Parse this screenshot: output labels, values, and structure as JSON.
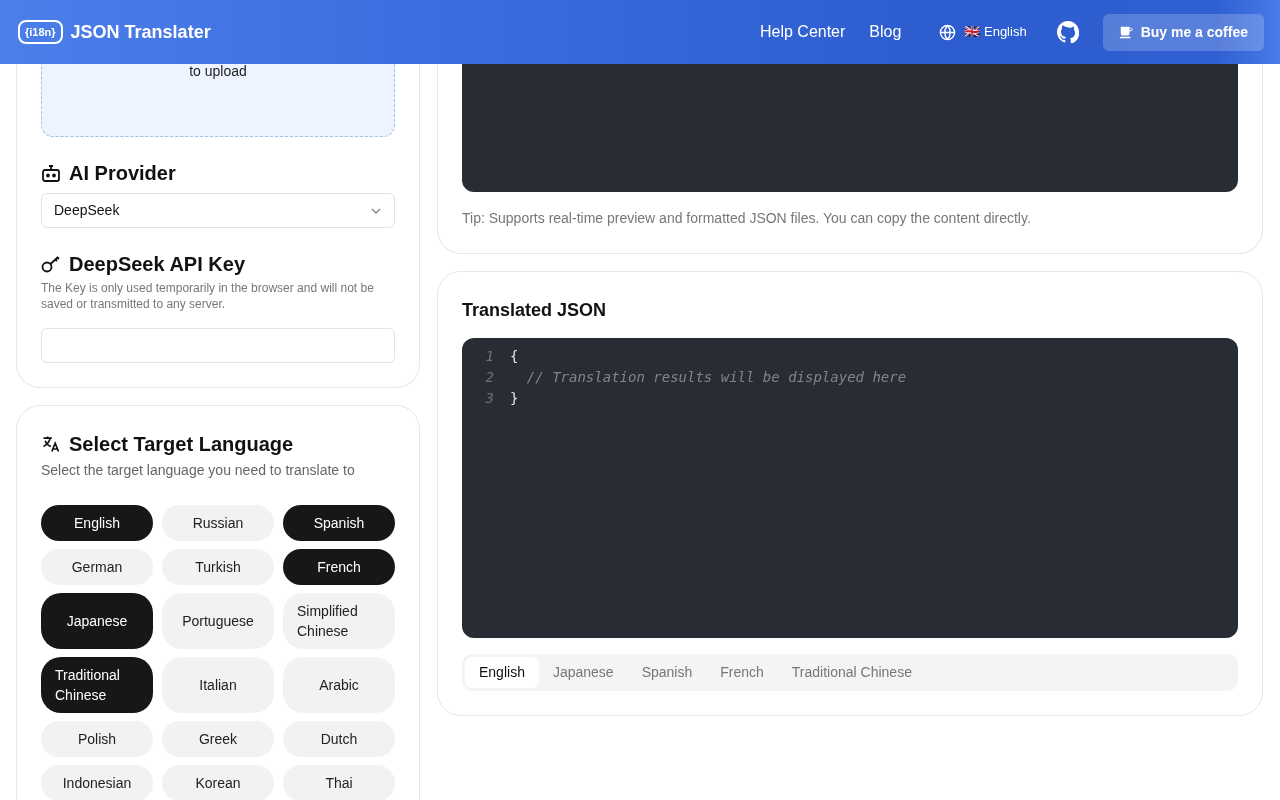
{
  "header": {
    "logo_text": "{i18n}",
    "title": "JSON Translater",
    "nav": [
      "Help Center",
      "Blog"
    ],
    "language": {
      "flag": "🇬🇧",
      "label": "English"
    },
    "coffee_button": "Buy me a coffee"
  },
  "upload": {
    "text": "to upload"
  },
  "provider": {
    "heading": "AI Provider",
    "value": "DeepSeek"
  },
  "api_key": {
    "heading": "DeepSeek API Key",
    "help": "The Key is only used temporarily in the browser and will not be saved or transmitted to any server."
  },
  "target": {
    "heading": "Select Target Language",
    "subtitle": "Select the target language you need to translate to",
    "languages": [
      {
        "label": "English",
        "selected": true
      },
      {
        "label": "Russian",
        "selected": false
      },
      {
        "label": "Spanish",
        "selected": true
      },
      {
        "label": "German",
        "selected": false
      },
      {
        "label": "Turkish",
        "selected": false
      },
      {
        "label": "French",
        "selected": true
      },
      {
        "label": "Japanese",
        "selected": true
      },
      {
        "label": "Portuguese",
        "selected": false
      },
      {
        "label": "Simplified Chinese",
        "selected": false
      },
      {
        "label": "Traditional Chinese",
        "selected": true
      },
      {
        "label": "Italian",
        "selected": false
      },
      {
        "label": "Arabic",
        "selected": false
      },
      {
        "label": "Polish",
        "selected": false
      },
      {
        "label": "Greek",
        "selected": false
      },
      {
        "label": "Dutch",
        "selected": false
      },
      {
        "label": "Indonesian",
        "selected": false
      },
      {
        "label": "Korean",
        "selected": false
      },
      {
        "label": "Thai",
        "selected": false
      }
    ]
  },
  "source": {
    "tip": "Tip: Supports real-time preview and formatted JSON files. You can copy the content directly."
  },
  "translated": {
    "heading": "Translated JSON",
    "lines": [
      {
        "number": "1",
        "text": "{",
        "kind": "code"
      },
      {
        "number": "2",
        "text": "  // Translation results will be displayed here",
        "kind": "comment"
      },
      {
        "number": "3",
        "text": "}",
        "kind": "code"
      }
    ],
    "tabs": [
      {
        "label": "English",
        "selected": true
      },
      {
        "label": "Japanese",
        "selected": false
      },
      {
        "label": "Spanish",
        "selected": false
      },
      {
        "label": "French",
        "selected": false
      },
      {
        "label": "Traditional Chinese",
        "selected": false
      }
    ]
  }
}
